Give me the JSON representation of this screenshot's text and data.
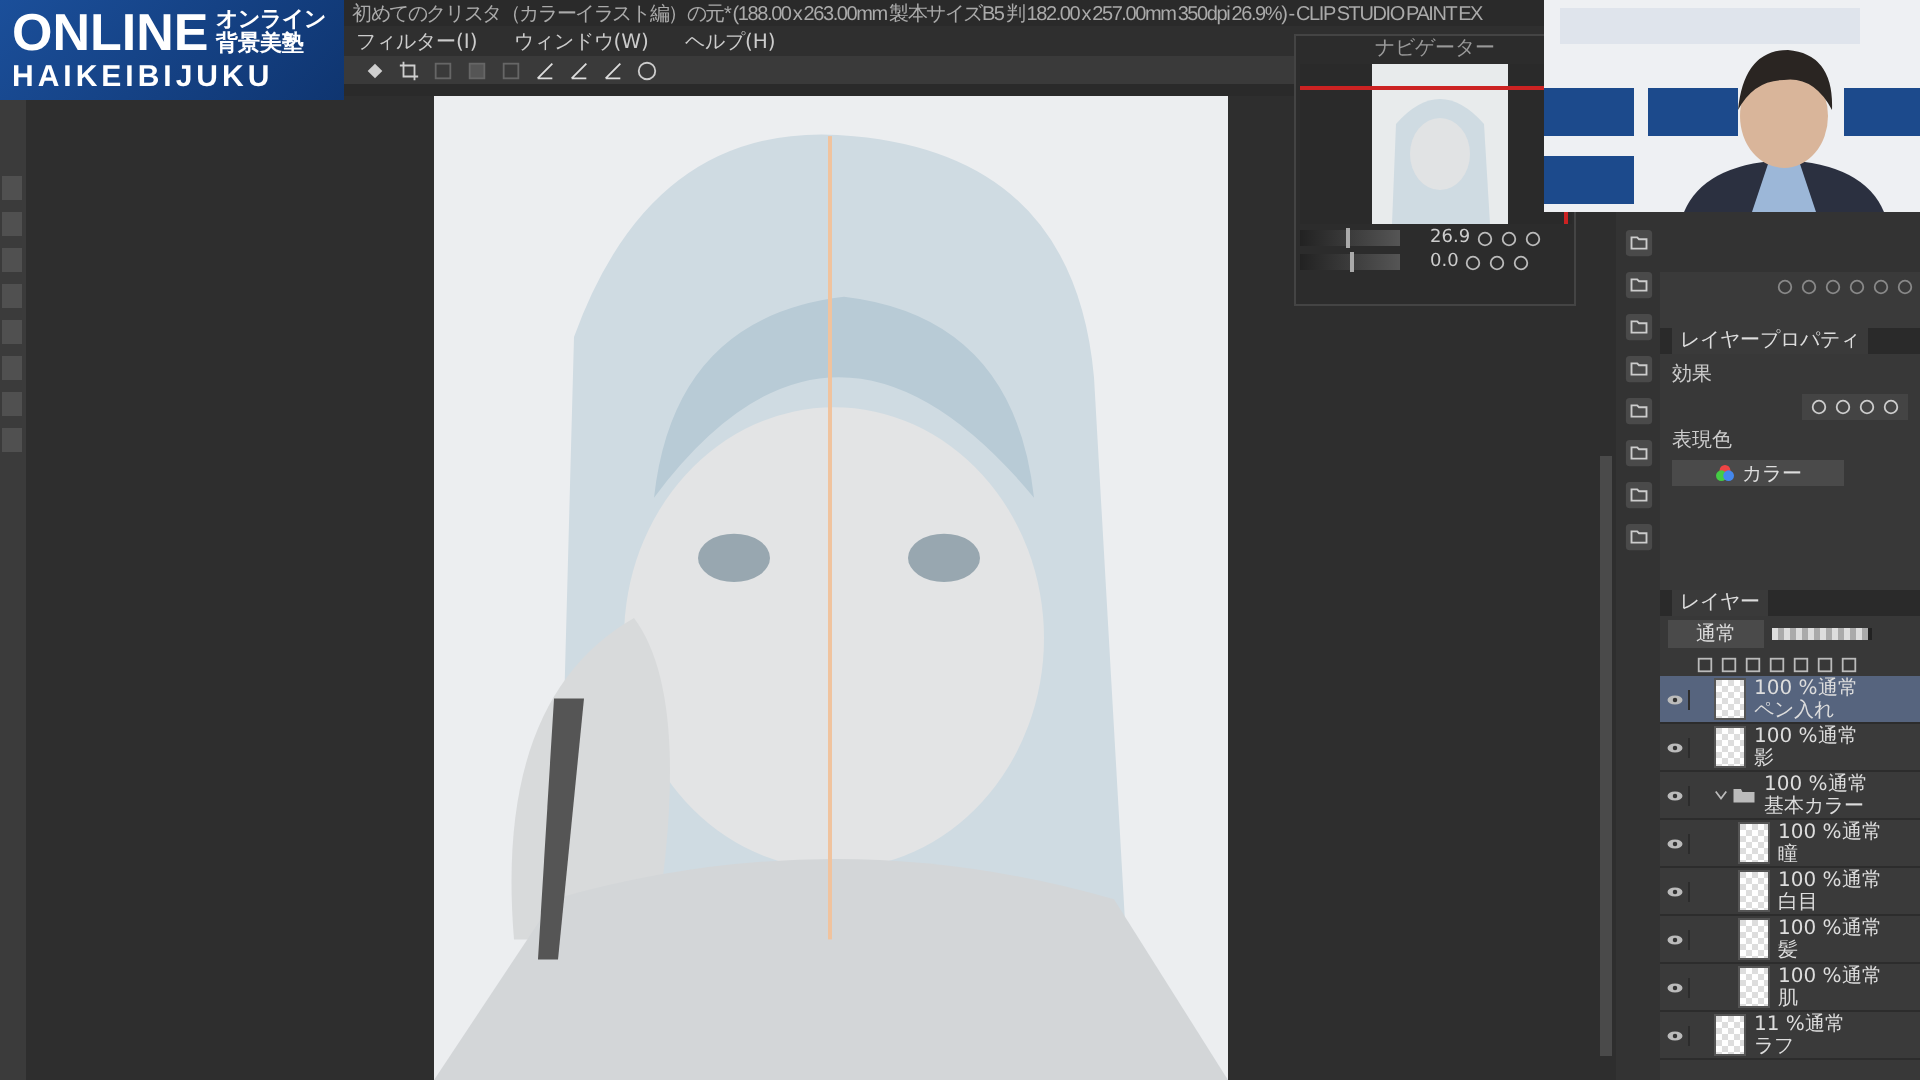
{
  "title": "初めてのクリスタ（カラーイラスト編）の元* (188.00 x 263.00mm 製本サイズB5 判 182.00 x 257.00mm 350dpi 26.9%) - CLIP STUDIO PAINT EX",
  "logo": {
    "word": "ONLINE",
    "kana": "オンライン",
    "kanji": "背景美塾",
    "roman": "HAIKEIBIJUKU"
  },
  "menu": [
    "フィルター(I)",
    "ウィンドウ(W)",
    "ヘルプ(H)"
  ],
  "navigator": {
    "title": "ナビゲーター",
    "zoom": "26.9",
    "angle": "0.0",
    "zoom_slider": {
      "level": 0.45
    },
    "rotation_slider": {
      "level": 0.5
    }
  },
  "layer_property": {
    "tab": "レイヤープロパティ",
    "effect_label": "効果",
    "color_label": "表現色",
    "color_mode": "カラー"
  },
  "layers_panel": {
    "tab": "レイヤー",
    "blend_mode": "通常",
    "opacity": {
      "level": 0.95
    },
    "layers": [
      {
        "kind": "layer",
        "info": "100 %通常",
        "name": "ペン入れ",
        "visible": true,
        "selected": true
      },
      {
        "kind": "layer",
        "info": "100 %通常",
        "name": "影",
        "visible": true,
        "selected": false
      },
      {
        "kind": "folder",
        "info": "100 %通常",
        "name": "基本カラー",
        "visible": true,
        "selected": false,
        "expanded": true,
        "children": [
          {
            "kind": "layer",
            "info": "100 %通常",
            "name": "瞳",
            "visible": true,
            "selected": false
          },
          {
            "kind": "layer",
            "info": "100 %通常",
            "name": "白目",
            "visible": true,
            "selected": false
          },
          {
            "kind": "layer",
            "info": "100 %通常",
            "name": "髪",
            "visible": true,
            "selected": false
          },
          {
            "kind": "layer",
            "info": "100 %通常",
            "name": "肌",
            "visible": true,
            "selected": false
          }
        ]
      },
      {
        "kind": "layer",
        "info": "11 %通常",
        "name": "ラフ",
        "visible": true,
        "selected": false
      }
    ]
  }
}
